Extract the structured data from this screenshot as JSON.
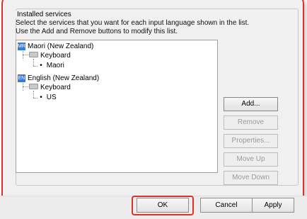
{
  "group": {
    "title": "Installed services",
    "description_line1": "Select the services that you want for each input language shown in the list.",
    "description_line2": "Use the Add and Remove buttons to modify this list."
  },
  "tree": {
    "lang1": {
      "badge": "MR",
      "label": "Maori (New Zealand)",
      "category": "Keyboard",
      "service": "Maori"
    },
    "lang2": {
      "badge": "EN",
      "label": "English (New Zealand)",
      "category": "Keyboard",
      "service": "US"
    }
  },
  "side_buttons": {
    "add": "Add...",
    "remove": "Remove",
    "properties": "Properties...",
    "move_up": "Move Up",
    "move_down": "Move Down"
  },
  "footer": {
    "ok": "OK",
    "cancel": "Cancel",
    "apply": "Apply"
  },
  "colors": {
    "highlight": "#d8322c",
    "badge": "#3a7bd5"
  }
}
